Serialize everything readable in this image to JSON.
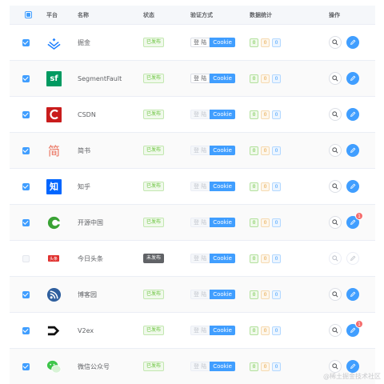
{
  "header": {
    "platform": "平台",
    "name": "名称",
    "status": "状态",
    "auth": "验证方式",
    "stats": "数据统计",
    "ops": "操作"
  },
  "labels": {
    "login": "登 陆",
    "cookie": "Cookie"
  },
  "rows": [
    {
      "name": "掘金",
      "status": "已发布",
      "checked": true,
      "logo": "juejin-logo",
      "login_disabled": false,
      "stats": [
        "0",
        "0",
        "0"
      ],
      "badge": "",
      "disabled": false
    },
    {
      "name": "SegmentFault",
      "status": "已发布",
      "checked": true,
      "logo": "segmentfault-logo",
      "login_disabled": false,
      "stats": [
        "0",
        "0",
        "0"
      ],
      "badge": "",
      "disabled": false
    },
    {
      "name": "CSDN",
      "status": "已发布",
      "checked": true,
      "logo": "csdn-logo",
      "login_disabled": true,
      "stats": [
        "0",
        "0",
        "0"
      ],
      "badge": "",
      "disabled": false
    },
    {
      "name": "简书",
      "status": "已发布",
      "checked": true,
      "logo": "jianshu-logo",
      "login_disabled": true,
      "stats": [
        "0",
        "0",
        "0"
      ],
      "badge": "",
      "disabled": false
    },
    {
      "name": "知乎",
      "status": "已发布",
      "checked": true,
      "logo": "zhihu-logo",
      "login_disabled": true,
      "stats": [
        "0",
        "0",
        "0"
      ],
      "badge": "",
      "disabled": false
    },
    {
      "name": "开源中国",
      "status": "已发布",
      "checked": true,
      "logo": "oschina-logo",
      "login_disabled": true,
      "stats": [
        "0",
        "0",
        "0"
      ],
      "badge": "1",
      "disabled": false
    },
    {
      "name": "今日头条",
      "status": "未发布",
      "checked": false,
      "logo": "toutiao-logo",
      "login_disabled": true,
      "stats": [
        "0",
        "0",
        "0"
      ],
      "badge": "",
      "disabled": true
    },
    {
      "name": "博客园",
      "status": "已发布",
      "checked": true,
      "logo": "cnblogs-logo",
      "login_disabled": true,
      "stats": [
        "0",
        "0",
        "0"
      ],
      "badge": "",
      "disabled": false
    },
    {
      "name": "V2ex",
      "status": "已发布",
      "checked": true,
      "logo": "v2ex-logo",
      "login_disabled": true,
      "stats": [
        "0",
        "0",
        "0"
      ],
      "badge": "1",
      "disabled": false
    },
    {
      "name": "微信公众号",
      "status": "已发布",
      "checked": true,
      "logo": "wechat-logo",
      "login_disabled": true,
      "stats": [
        "0",
        "0",
        "0"
      ],
      "badge": "",
      "disabled": false
    }
  ],
  "logo_text": {
    "segmentfault": "sf",
    "jianshu": "简",
    "zhihu": "知",
    "toutiao": "头条"
  },
  "watermark": "@稀土掘金技术社区",
  "colors": {
    "primary": "#409eff",
    "success": "#67c23a",
    "warning": "#e6a23c",
    "danger": "#f56c6c"
  }
}
